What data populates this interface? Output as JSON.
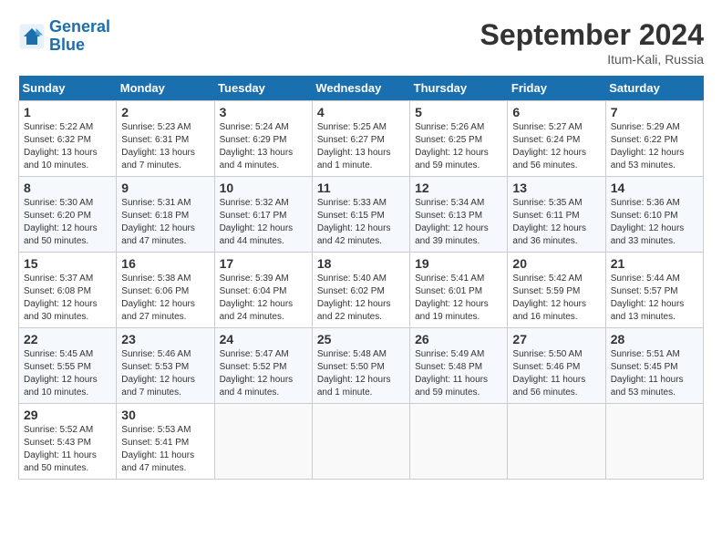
{
  "logo": {
    "line1": "General",
    "line2": "Blue"
  },
  "title": "September 2024",
  "subtitle": "Itum-Kali, Russia",
  "days_header": [
    "Sunday",
    "Monday",
    "Tuesday",
    "Wednesday",
    "Thursday",
    "Friday",
    "Saturday"
  ],
  "weeks": [
    [
      {
        "num": "1",
        "info": "Sunrise: 5:22 AM\nSunset: 6:32 PM\nDaylight: 13 hours\nand 10 minutes."
      },
      {
        "num": "2",
        "info": "Sunrise: 5:23 AM\nSunset: 6:31 PM\nDaylight: 13 hours\nand 7 minutes."
      },
      {
        "num": "3",
        "info": "Sunrise: 5:24 AM\nSunset: 6:29 PM\nDaylight: 13 hours\nand 4 minutes."
      },
      {
        "num": "4",
        "info": "Sunrise: 5:25 AM\nSunset: 6:27 PM\nDaylight: 13 hours\nand 1 minute."
      },
      {
        "num": "5",
        "info": "Sunrise: 5:26 AM\nSunset: 6:25 PM\nDaylight: 12 hours\nand 59 minutes."
      },
      {
        "num": "6",
        "info": "Sunrise: 5:27 AM\nSunset: 6:24 PM\nDaylight: 12 hours\nand 56 minutes."
      },
      {
        "num": "7",
        "info": "Sunrise: 5:29 AM\nSunset: 6:22 PM\nDaylight: 12 hours\nand 53 minutes."
      }
    ],
    [
      {
        "num": "8",
        "info": "Sunrise: 5:30 AM\nSunset: 6:20 PM\nDaylight: 12 hours\nand 50 minutes."
      },
      {
        "num": "9",
        "info": "Sunrise: 5:31 AM\nSunset: 6:18 PM\nDaylight: 12 hours\nand 47 minutes."
      },
      {
        "num": "10",
        "info": "Sunrise: 5:32 AM\nSunset: 6:17 PM\nDaylight: 12 hours\nand 44 minutes."
      },
      {
        "num": "11",
        "info": "Sunrise: 5:33 AM\nSunset: 6:15 PM\nDaylight: 12 hours\nand 42 minutes."
      },
      {
        "num": "12",
        "info": "Sunrise: 5:34 AM\nSunset: 6:13 PM\nDaylight: 12 hours\nand 39 minutes."
      },
      {
        "num": "13",
        "info": "Sunrise: 5:35 AM\nSunset: 6:11 PM\nDaylight: 12 hours\nand 36 minutes."
      },
      {
        "num": "14",
        "info": "Sunrise: 5:36 AM\nSunset: 6:10 PM\nDaylight: 12 hours\nand 33 minutes."
      }
    ],
    [
      {
        "num": "15",
        "info": "Sunrise: 5:37 AM\nSunset: 6:08 PM\nDaylight: 12 hours\nand 30 minutes."
      },
      {
        "num": "16",
        "info": "Sunrise: 5:38 AM\nSunset: 6:06 PM\nDaylight: 12 hours\nand 27 minutes."
      },
      {
        "num": "17",
        "info": "Sunrise: 5:39 AM\nSunset: 6:04 PM\nDaylight: 12 hours\nand 24 minutes."
      },
      {
        "num": "18",
        "info": "Sunrise: 5:40 AM\nSunset: 6:02 PM\nDaylight: 12 hours\nand 22 minutes."
      },
      {
        "num": "19",
        "info": "Sunrise: 5:41 AM\nSunset: 6:01 PM\nDaylight: 12 hours\nand 19 minutes."
      },
      {
        "num": "20",
        "info": "Sunrise: 5:42 AM\nSunset: 5:59 PM\nDaylight: 12 hours\nand 16 minutes."
      },
      {
        "num": "21",
        "info": "Sunrise: 5:44 AM\nSunset: 5:57 PM\nDaylight: 12 hours\nand 13 minutes."
      }
    ],
    [
      {
        "num": "22",
        "info": "Sunrise: 5:45 AM\nSunset: 5:55 PM\nDaylight: 12 hours\nand 10 minutes."
      },
      {
        "num": "23",
        "info": "Sunrise: 5:46 AM\nSunset: 5:53 PM\nDaylight: 12 hours\nand 7 minutes."
      },
      {
        "num": "24",
        "info": "Sunrise: 5:47 AM\nSunset: 5:52 PM\nDaylight: 12 hours\nand 4 minutes."
      },
      {
        "num": "25",
        "info": "Sunrise: 5:48 AM\nSunset: 5:50 PM\nDaylight: 12 hours\nand 1 minute."
      },
      {
        "num": "26",
        "info": "Sunrise: 5:49 AM\nSunset: 5:48 PM\nDaylight: 11 hours\nand 59 minutes."
      },
      {
        "num": "27",
        "info": "Sunrise: 5:50 AM\nSunset: 5:46 PM\nDaylight: 11 hours\nand 56 minutes."
      },
      {
        "num": "28",
        "info": "Sunrise: 5:51 AM\nSunset: 5:45 PM\nDaylight: 11 hours\nand 53 minutes."
      }
    ],
    [
      {
        "num": "29",
        "info": "Sunrise: 5:52 AM\nSunset: 5:43 PM\nDaylight: 11 hours\nand 50 minutes."
      },
      {
        "num": "30",
        "info": "Sunrise: 5:53 AM\nSunset: 5:41 PM\nDaylight: 11 hours\nand 47 minutes."
      },
      null,
      null,
      null,
      null,
      null
    ]
  ]
}
